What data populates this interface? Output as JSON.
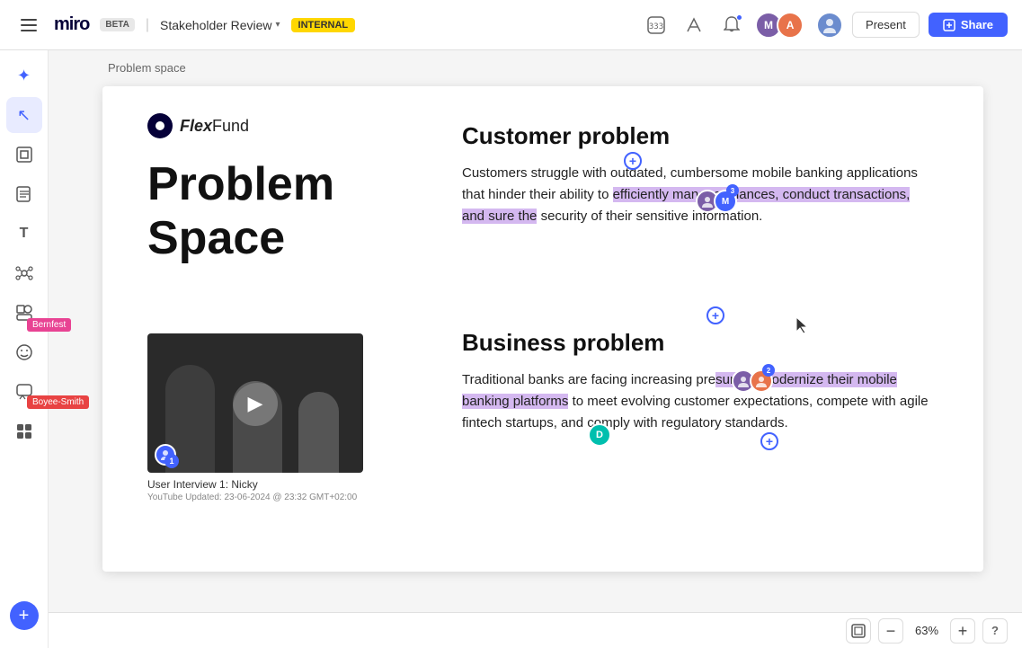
{
  "topbar": {
    "logo": "miro",
    "beta_label": "BETA",
    "board_name": "Stakeholder Review",
    "internal_badge": "INTERNAL",
    "present_label": "Present",
    "share_label": "Share"
  },
  "breadcrumb": {
    "text": "Problem space"
  },
  "sidebar": {
    "items": [
      {
        "icon": "✦",
        "name": "magic-tool",
        "active": false
      },
      {
        "icon": "↖",
        "name": "select-tool",
        "active": true
      },
      {
        "icon": "▦",
        "name": "frames-tool",
        "active": false
      },
      {
        "icon": "🗒",
        "name": "sticky-note-tool",
        "active": false
      },
      {
        "icon": "T",
        "name": "text-tool",
        "active": false
      },
      {
        "icon": "⚇",
        "name": "mindmap-tool",
        "active": false
      },
      {
        "icon": "⊞",
        "name": "shapes-tool",
        "active": false
      },
      {
        "icon": "☺",
        "name": "emoji-tool",
        "active": false
      },
      {
        "icon": "💬",
        "name": "comment-tool",
        "active": false
      },
      {
        "icon": "⊕",
        "name": "apps-tool",
        "active": false
      }
    ],
    "add_label": "+"
  },
  "canvas": {
    "brand_name": "FlexFund",
    "problem_heading": "Problem Space",
    "customer_problem": {
      "title": "Customer problem",
      "body_plain": "Customers struggle with outdated, cumbersome mobile banking applications that hinder their ability to ",
      "body_highlight": "efficiently manage finances, conduct transactions, and ",
      "body_sure": "sure the",
      "body_end": " security of their sensitive information."
    },
    "business_problem": {
      "title": "Business problem",
      "body_plain": "Traditional banks are facing increasing ",
      "body_highlight_pressure": "sure",
      "body_to": " to ",
      "body_highlight_modernize": "modernize their mobile banking platforms",
      "body_end": " to meet evolving customer expectations, compete with agile fintech st",
      "body_ups": "artups, and comply with regulatory standards."
    },
    "video": {
      "title": "User Interview 1: Nicky",
      "meta": "YouTube  Updated: 23-06-2024 @ 23:32 GMT+02:00"
    }
  },
  "bottombar": {
    "zoom_level": "63%"
  },
  "collaborators": {
    "group1_count": "3",
    "video_badge": "1"
  }
}
